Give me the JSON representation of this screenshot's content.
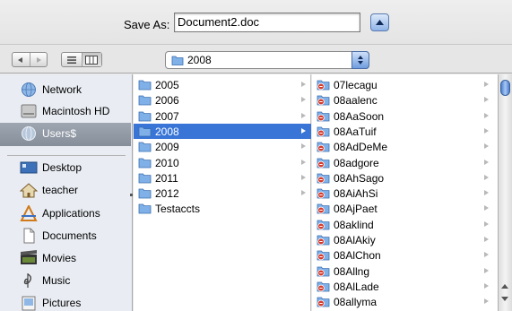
{
  "save_bar": {
    "label": "Save As:",
    "filename": "Document2.doc",
    "collapse_icon": "triangle-up-icon"
  },
  "toolbar": {
    "back_icon": "back-arrow-icon",
    "forward_icon": "forward-arrow-icon",
    "list_view_icon": "list-view-icon",
    "column_view_icon": "column-view-icon",
    "location": "2008"
  },
  "sidebar": {
    "items": [
      {
        "label": "Network",
        "icon": "network-globe-icon"
      },
      {
        "label": "Macintosh HD",
        "icon": "hard-drive-icon"
      },
      {
        "label": "Users$",
        "icon": "network-share-icon",
        "selected": true
      },
      {
        "label": "Desktop",
        "icon": "desktop-icon"
      },
      {
        "label": "teacher",
        "icon": "home-icon"
      },
      {
        "label": "Applications",
        "icon": "applications-icon"
      },
      {
        "label": "Documents",
        "icon": "documents-icon"
      },
      {
        "label": "Movies",
        "icon": "movies-icon"
      },
      {
        "label": "Music",
        "icon": "music-note-icon"
      },
      {
        "label": "Pictures",
        "icon": "pictures-icon"
      }
    ]
  },
  "folders_column": {
    "items": [
      "2005",
      "2006",
      "2007",
      "2008",
      "2009",
      "2010",
      "2011",
      "2012",
      "Testaccts"
    ],
    "selected_index": 3
  },
  "files_column": {
    "items": [
      "07lecagu",
      "08aalenc",
      "08AaSoon",
      "08AaTuif",
      "08AdDeMe",
      "08adgore",
      "08AhSago",
      "08AiAhSi",
      "08AjPaet",
      "08aklind",
      "08AlAkiy",
      "08AlChon",
      "08Allng",
      "08AlLade",
      "08allyma"
    ]
  },
  "colors": {
    "selection": "#3875d7",
    "sidebar_bg": "#e9edf3",
    "sidebar_selected": "#8e96a2",
    "folder_blue": "#5b95d6"
  }
}
